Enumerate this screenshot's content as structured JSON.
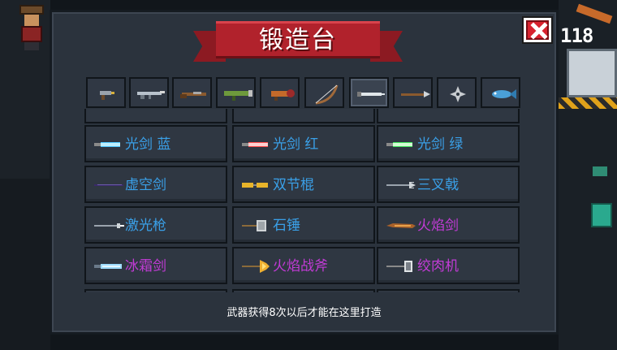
{
  "title": "锻造台",
  "score": "118",
  "footer_note": "武器获得8次以后才能在这里打造",
  "close_icon": "close-x-icon",
  "colors": {
    "blue_label": "#3aa0e8",
    "purple_label": "#c23bd6",
    "orange_label": "#e08a1a"
  },
  "tabs": [
    {
      "icon": "pistol-icon"
    },
    {
      "icon": "rifle-icon"
    },
    {
      "icon": "shotgun-icon"
    },
    {
      "icon": "rocket-launcher-icon"
    },
    {
      "icon": "bomb-launcher-icon"
    },
    {
      "icon": "bow-icon"
    },
    {
      "icon": "sword-icon"
    },
    {
      "icon": "spear-icon"
    },
    {
      "icon": "shuriken-icon"
    },
    {
      "icon": "fish-icon"
    }
  ],
  "weapons": [
    {
      "label": "光剑 蓝",
      "color": "#3aa0e8",
      "icon": "lightsaber-blue-icon"
    },
    {
      "label": "光剑 红",
      "color": "#3aa0e8",
      "icon": "lightsaber-red-icon"
    },
    {
      "label": "光剑 绿",
      "color": "#3aa0e8",
      "icon": "lightsaber-green-icon"
    },
    {
      "label": "虚空剑",
      "color": "#3aa0e8",
      "icon": "void-sword-icon"
    },
    {
      "label": "双节棍",
      "color": "#3aa0e8",
      "icon": "nunchaku-icon"
    },
    {
      "label": "三叉戟",
      "color": "#3aa0e8",
      "icon": "trident-icon"
    },
    {
      "label": "激光枪",
      "color": "#3aa0e8",
      "icon": "laser-spear-icon"
    },
    {
      "label": "石锤",
      "color": "#3aa0e8",
      "icon": "stone-hammer-icon"
    },
    {
      "label": "火焰剑",
      "color": "#c23bd6",
      "icon": "flame-sword-icon"
    },
    {
      "label": "冰霜剑",
      "color": "#c23bd6",
      "icon": "frost-sword-icon"
    },
    {
      "label": "火焰战斧",
      "color": "#c23bd6",
      "icon": "flame-axe-icon"
    },
    {
      "label": "绞肉机",
      "color": "#c23bd6",
      "icon": "meat-grinder-icon"
    }
  ]
}
